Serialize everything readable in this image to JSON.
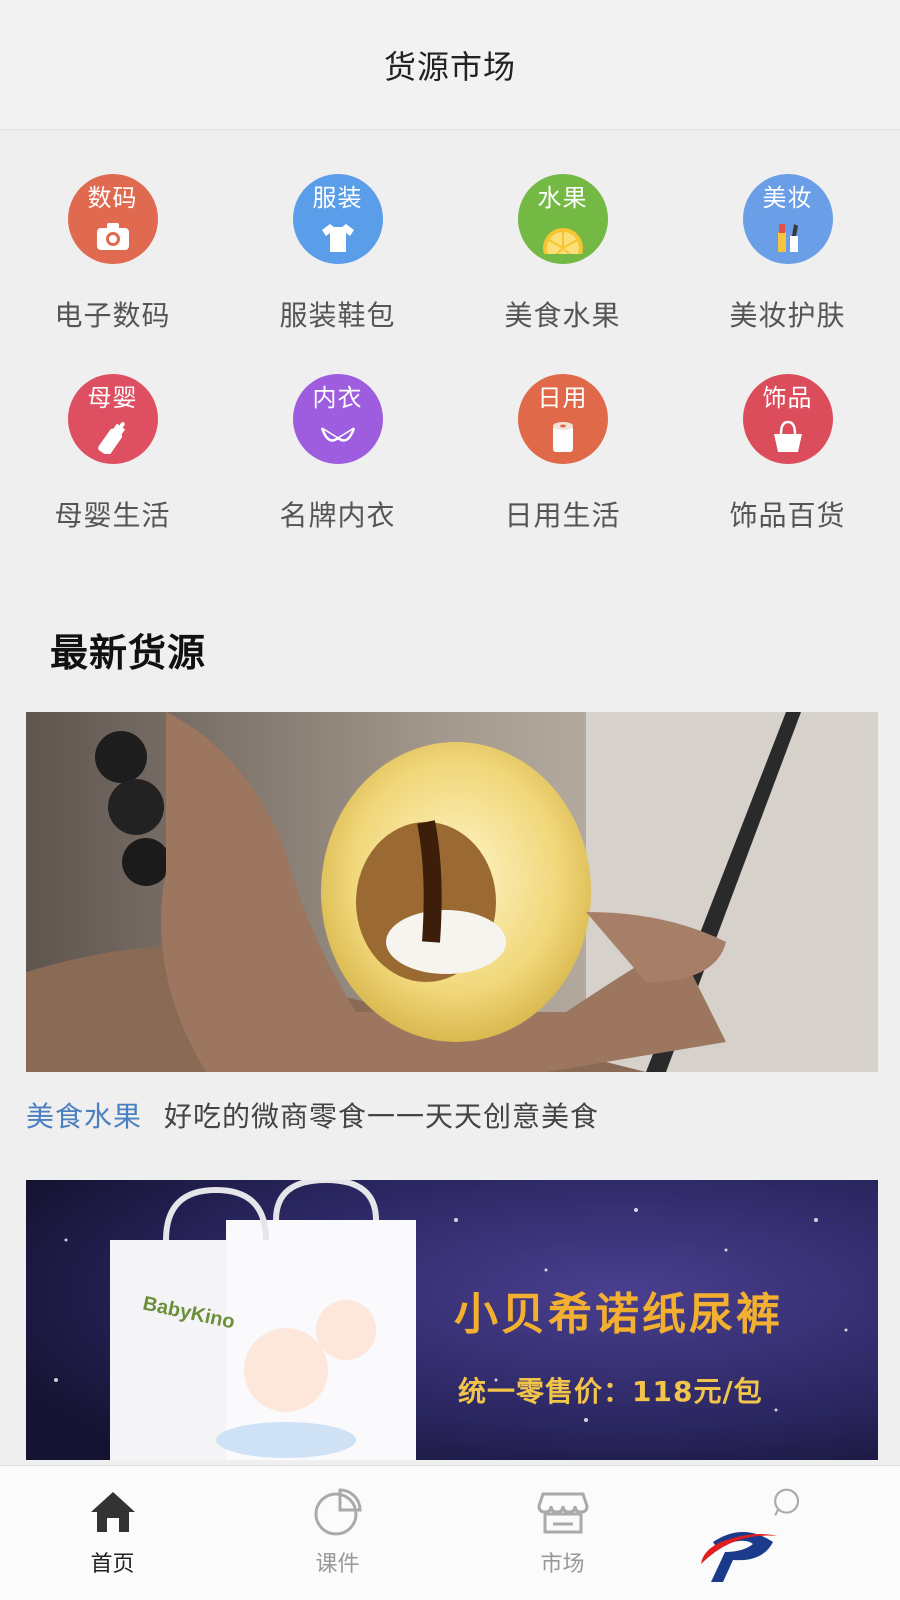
{
  "header": {
    "title": "货源市场"
  },
  "categories": [
    {
      "badge": "数码",
      "label": "电子数码",
      "color": "#e06a4f",
      "icon": "camera-icon"
    },
    {
      "badge": "服装",
      "label": "服装鞋包",
      "color": "#5a9de8",
      "icon": "tshirt-icon"
    },
    {
      "badge": "水果",
      "label": "美食水果",
      "color": "#74b944",
      "icon": "lemon-icon"
    },
    {
      "badge": "美妆",
      "label": "美妆护肤",
      "color": "#6a9ee6",
      "icon": "makeup-icon"
    },
    {
      "badge": "母婴",
      "label": "母婴生活",
      "color": "#de4f61",
      "icon": "baby-bottle-icon"
    },
    {
      "badge": "内衣",
      "label": "名牌内衣",
      "color": "#9e5cde",
      "icon": "bra-icon"
    },
    {
      "badge": "日用",
      "label": "日用生活",
      "color": "#e0694a",
      "icon": "tissue-roll-icon"
    },
    {
      "badge": "饰品",
      "label": "饰品百货",
      "color": "#dc4d5c",
      "icon": "shopping-bag-icon"
    }
  ],
  "latest": {
    "title": "最新货源",
    "items": [
      {
        "tag": "美食水果",
        "text": "好吃的微商零食一一天天创意美食"
      }
    ],
    "banner": {
      "headline": "小贝希诺纸尿裤",
      "price_text": "统一零售价：118元/包",
      "brand": "BabyKino"
    }
  },
  "tabbar": {
    "items": [
      {
        "label": "首页",
        "active": true
      },
      {
        "label": "课件",
        "active": false
      },
      {
        "label": "市场",
        "active": false
      },
      {
        "label": "",
        "active": false
      }
    ]
  }
}
